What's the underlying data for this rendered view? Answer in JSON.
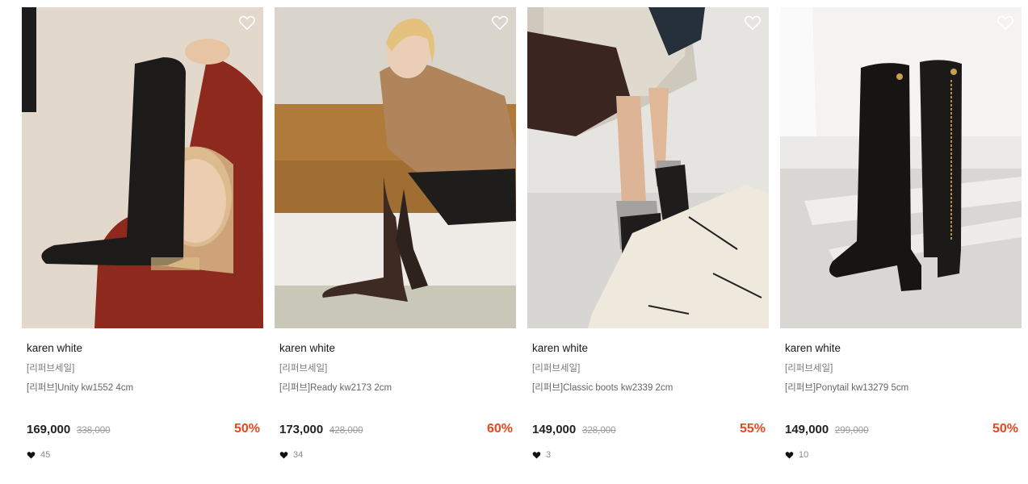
{
  "products": [
    {
      "brand": "karen white",
      "tag": "[리퍼브세일]",
      "name": "[리퍼브]Unity kw1552 4cm",
      "price": "169,000",
      "original_price": "338,000",
      "discount": "50%",
      "likes": "45"
    },
    {
      "brand": "karen white",
      "tag": "[리퍼브세일]",
      "name": "[리퍼브]Ready kw2173 2cm",
      "price": "173,000",
      "original_price": "428,000",
      "discount": "60%",
      "likes": "34"
    },
    {
      "brand": "karen white",
      "tag": "[리퍼브세일]",
      "name": "[리퍼브]Classic boots kw2339 2cm",
      "price": "149,000",
      "original_price": "328,000",
      "discount": "55%",
      "likes": "3"
    },
    {
      "brand": "karen white",
      "tag": "[리퍼브세일]",
      "name": "[리퍼브]Ponytail kw13279 5cm",
      "price": "149,000",
      "original_price": "299,000",
      "discount": "50%",
      "likes": "10"
    }
  ],
  "colors": {
    "discount": "#e8481c",
    "text": "#222222",
    "muted": "#777777"
  },
  "icons": {
    "wishlist": "heart-outline-icon",
    "likes": "heart-filled-icon"
  }
}
